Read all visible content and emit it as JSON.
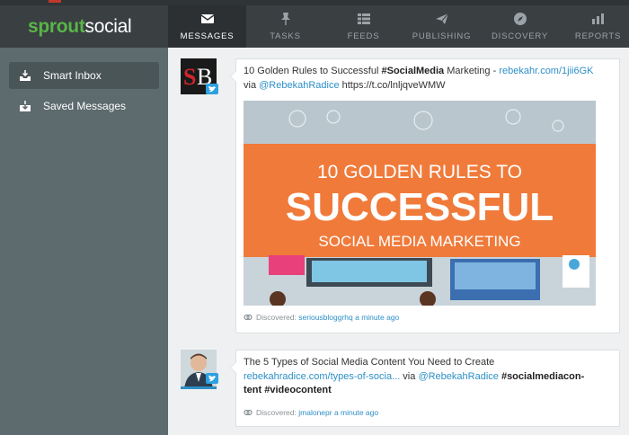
{
  "brand": {
    "part1": "sprout",
    "part2": "social",
    "accent": "#59b548"
  },
  "nav": [
    {
      "label": "MESSAGES",
      "icon": "envelope-icon",
      "active": true
    },
    {
      "label": "TASKS",
      "icon": "pin-icon"
    },
    {
      "label": "FEEDS",
      "icon": "list-icon"
    },
    {
      "label": "PUBLISHING",
      "icon": "paper-plane-icon"
    },
    {
      "label": "DISCOVERY",
      "icon": "compass-icon"
    },
    {
      "label": "REPORTS",
      "icon": "bar-chart-icon"
    }
  ],
  "sidebar": {
    "items": [
      {
        "label": "Smart Inbox",
        "icon": "inbox-tray-icon",
        "active": true
      },
      {
        "label": "Saved Messages",
        "icon": "download-tray-icon"
      }
    ]
  },
  "messages": [
    {
      "text_pre": "10 Golden Rules to Successful ",
      "hashtag": "#SocialMedia",
      "text_mid": " Marketing - ",
      "link": "rebekahr.com/1jii6GK",
      "via": "via ",
      "mention": "@RebekahRadice",
      "tail": " https://t.co/lnljqveWMW",
      "image": {
        "line1": "10 GOLDEN RULES TO",
        "line2": "SUCCESSFUL",
        "line3": "SOCIAL MEDIA MARKETING"
      },
      "discovered_label": "Discovered:",
      "discovered_by": "seriousbloggrhq",
      "time": "a minute ago"
    },
    {
      "text_pre": "The 5 Types of Social Media Content You Need to Create",
      "link": "rebekahradice.com/types-of-socia...",
      "via": " via ",
      "mention": "@RebekahRadice",
      "hashtag1": " #socialmediacon-",
      "hashtag2": "tent #videocontent",
      "discovered_label": "Discovered:",
      "discovered_by": "jmalonepr",
      "time": "a minute ago"
    }
  ]
}
